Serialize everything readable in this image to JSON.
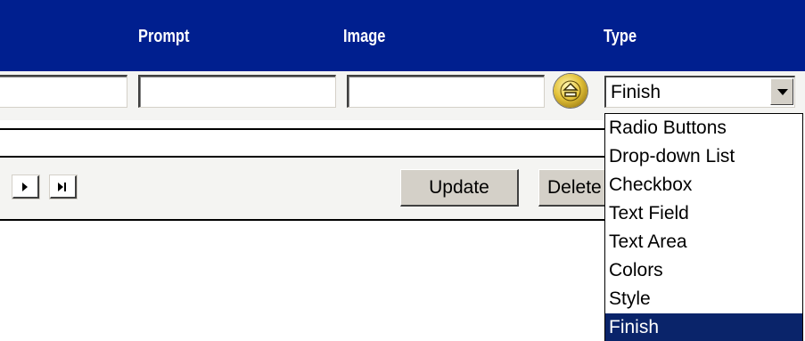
{
  "header": {
    "columns": [
      "Prompt",
      "Image",
      "Type"
    ]
  },
  "type_select": {
    "value": "Finish",
    "options": [
      "Radio Buttons",
      "Drop-down List",
      "Checkbox",
      "Text Field",
      "Text Area",
      "Colors",
      "Style",
      "Finish"
    ],
    "selected_index": 7
  },
  "toolbar": {
    "update_label": "Update",
    "delete_label": "Delete"
  },
  "colors": {
    "header_bg": "#001f8f",
    "selection": "#0a246a"
  },
  "icons": {
    "lookup": "eject-lookup-icon",
    "next": "next-record-icon",
    "last": "last-record-icon"
  }
}
